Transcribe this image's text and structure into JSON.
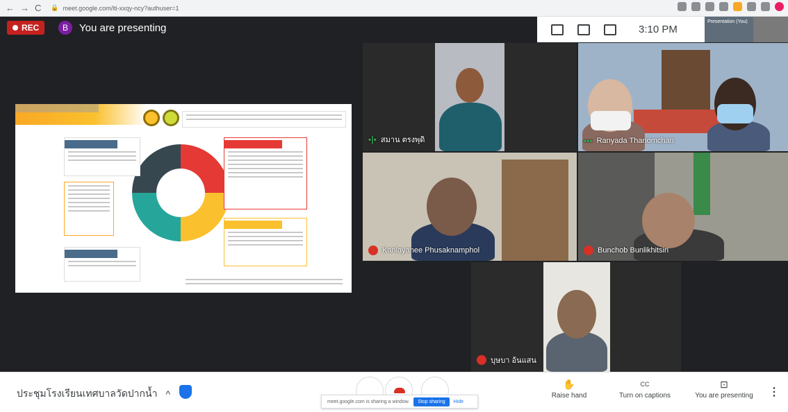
{
  "browser": {
    "url": "meet.google.com/lti-xxqy-ncy?authuser=1",
    "back_glyph": "←",
    "forward_glyph": "→",
    "reload_glyph": "C"
  },
  "header": {
    "rec_label": "REC",
    "presenter_initial": "B",
    "presenting_text": "You are presenting",
    "time": "3:10 PM",
    "thumb_label": "Presentation (You)"
  },
  "participants": [
    {
      "name": "สมาน ตรงพุดิ",
      "status": "speaking"
    },
    {
      "name": "Ranyada Thanomchan",
      "status": "speaking"
    },
    {
      "name": "Kanlayanee Phusaknamphol",
      "status": "muted"
    },
    {
      "name": "Bunchob Bunlikhitsiri",
      "status": "muted"
    },
    {
      "name": "บุษบา อ้นแสน",
      "status": "muted"
    }
  ],
  "footer": {
    "meeting_name": "ประชุมโรงเรียนเทศบาลวัดปากน้ำ",
    "chevron": "^",
    "share_notice": "meet.google.com is sharing a window.",
    "stop_sharing": "Stop sharing",
    "hide": "Hide",
    "raise_hand": "Raise hand",
    "captions": "Turn on captions",
    "you_are_presenting": "You are presenting",
    "more": "⋮"
  },
  "icons": {
    "raise_hand": "✋",
    "captions": "CC",
    "present": "⊡"
  },
  "colors": {
    "rec_red": "#c5221f",
    "avatar_purple": "#7b1fa2",
    "meet_blue": "#1a73e8",
    "stage_bg": "#202124"
  }
}
